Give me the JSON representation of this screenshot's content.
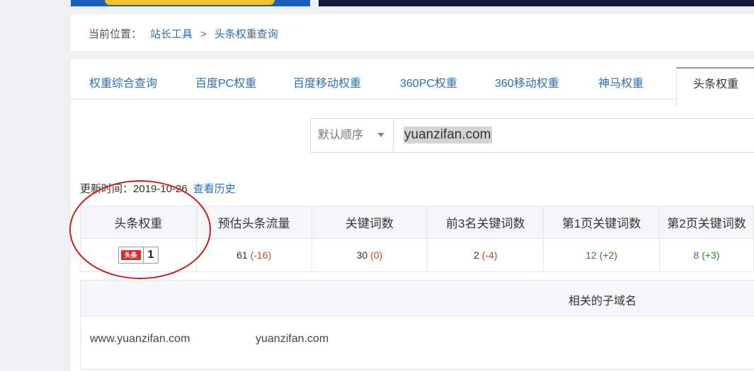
{
  "breadcrumb": {
    "prefix": "当前位置：",
    "items": [
      "站长工具",
      "头条权重查询"
    ],
    "separator": ">"
  },
  "tabs": [
    {
      "label": "权重综合查询",
      "active": false
    },
    {
      "label": "百度PC权重",
      "active": false
    },
    {
      "label": "百度移动权重",
      "active": false
    },
    {
      "label": "360PC权重",
      "active": false
    },
    {
      "label": "360移动权重",
      "active": false
    },
    {
      "label": "神马权重",
      "active": false
    },
    {
      "label": "头条权重",
      "active": true
    }
  ],
  "search": {
    "sort_selected": "默认顺序",
    "query": "yuanzifan.com"
  },
  "update": {
    "label": "更新时间：",
    "date": "2019-10-26",
    "history_link": "查看历史"
  },
  "stats_table": {
    "headers": [
      "头条权重",
      "预估头条流量",
      "关键词数",
      "前3名关键词数",
      "第1页关键词数",
      "第2页关键词数"
    ],
    "weight_badge": {
      "logo_text": "头条",
      "value": "1"
    },
    "row": [
      {
        "value": "61",
        "delta": "(-16)"
      },
      {
        "value": "30",
        "delta": "(0)"
      },
      {
        "value": "2",
        "delta": "(-4)"
      },
      {
        "value": "12",
        "delta": "(+2)"
      },
      {
        "value": "8",
        "delta": "(+3)"
      }
    ]
  },
  "subdomains": {
    "title": "相关的子域名",
    "items": [
      "www.yuanzifan.com",
      "yuanzifan.com"
    ]
  },
  "colors": {
    "link": "#2f6fb0",
    "negative": "#d9441c",
    "positive": "#2b8a2b",
    "annotation": "#d21a1a"
  }
}
